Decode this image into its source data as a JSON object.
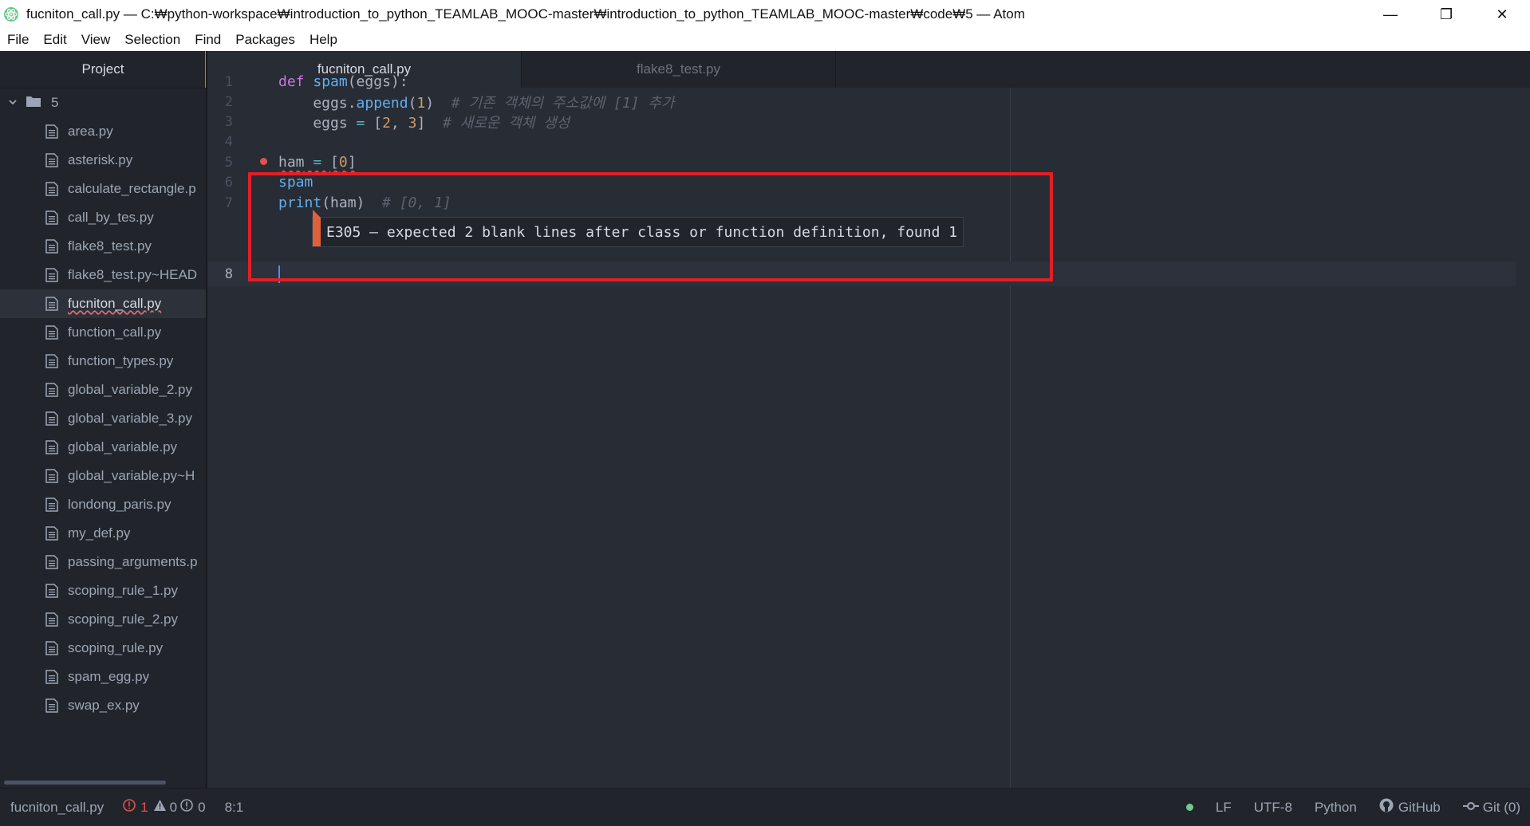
{
  "window": {
    "title": "fucniton_call.py — C:\\python-workspace\\introduction_to_python_TEAMLAB_MOOC-master\\introduction_to_python_TEAMLAB_MOOC-master\\code\\5 — Atom",
    "title_display": "fucniton_call.py — C:₩python-workspace₩introduction_to_python_TEAMLAB_MOOC-master₩introduction_to_python_TEAMLAB_MOOC-master₩code₩5 — Atom",
    "minimize": "—",
    "restore": "❐",
    "close": "✕"
  },
  "menu": [
    "File",
    "Edit",
    "View",
    "Selection",
    "Find",
    "Packages",
    "Help"
  ],
  "sidebar": {
    "header": "Project",
    "root_folder": "5",
    "files": [
      "area.py",
      "asterisk.py",
      "calculate_rectangle.p",
      "call_by_tes.py",
      "flake8_test.py",
      "flake8_test.py~HEAD",
      "fucniton_call.py",
      "function_call.py",
      "function_types.py",
      "global_variable_2.py",
      "global_variable_3.py",
      "global_variable.py",
      "global_variable.py~H",
      "londong_paris.py",
      "my_def.py",
      "passing_arguments.p",
      "scoping_rule_1.py",
      "scoping_rule_2.py",
      "scoping_rule.py",
      "spam_egg.py",
      "swap_ex.py"
    ],
    "selected_index": 6
  },
  "tabs": [
    {
      "label": "fucniton_call.py",
      "active": true
    },
    {
      "label": "flake8_test.py",
      "active": false
    }
  ],
  "editor": {
    "line_numbers": [
      "1",
      "2",
      "3",
      "4",
      "5",
      "6",
      "7",
      "8"
    ],
    "code": {
      "l1_kw": "def",
      "l1_fn": "spam",
      "l1_rest": "(eggs):",
      "l2_a": "    eggs.",
      "l2_fn": "append",
      "l2_b": "(",
      "l2_num": "1",
      "l2_c": ")  ",
      "l2_comment": "# 기존 객체의 주소값에 [1] 추가",
      "l3_a": "    eggs ",
      "l3_op": "=",
      "l3_b": " [",
      "l3_n1": "2",
      "l3_c": ", ",
      "l3_n2": "3",
      "l3_d": "]  ",
      "l3_comment": "# 새로운 객체 생성",
      "l5_a": "ham",
      "l5_op": " = ",
      "l5_b": "[",
      "l5_num": "0",
      "l5_c": "]",
      "l6_fn": "spam",
      "l7_fn": "print",
      "l7_a": "(ham)  ",
      "l7_comment": "# [0, 1]"
    },
    "lint_message": "E305 — expected 2 blank lines after class or function definition, found 1"
  },
  "status": {
    "file": "fucniton_call.py",
    "errors": "1",
    "warnings": "0",
    "infos": "0",
    "cursor": "8:1",
    "line_ending": "LF",
    "encoding": "UTF-8",
    "grammar": "Python",
    "github": "GitHub",
    "git": "Git (0)"
  }
}
